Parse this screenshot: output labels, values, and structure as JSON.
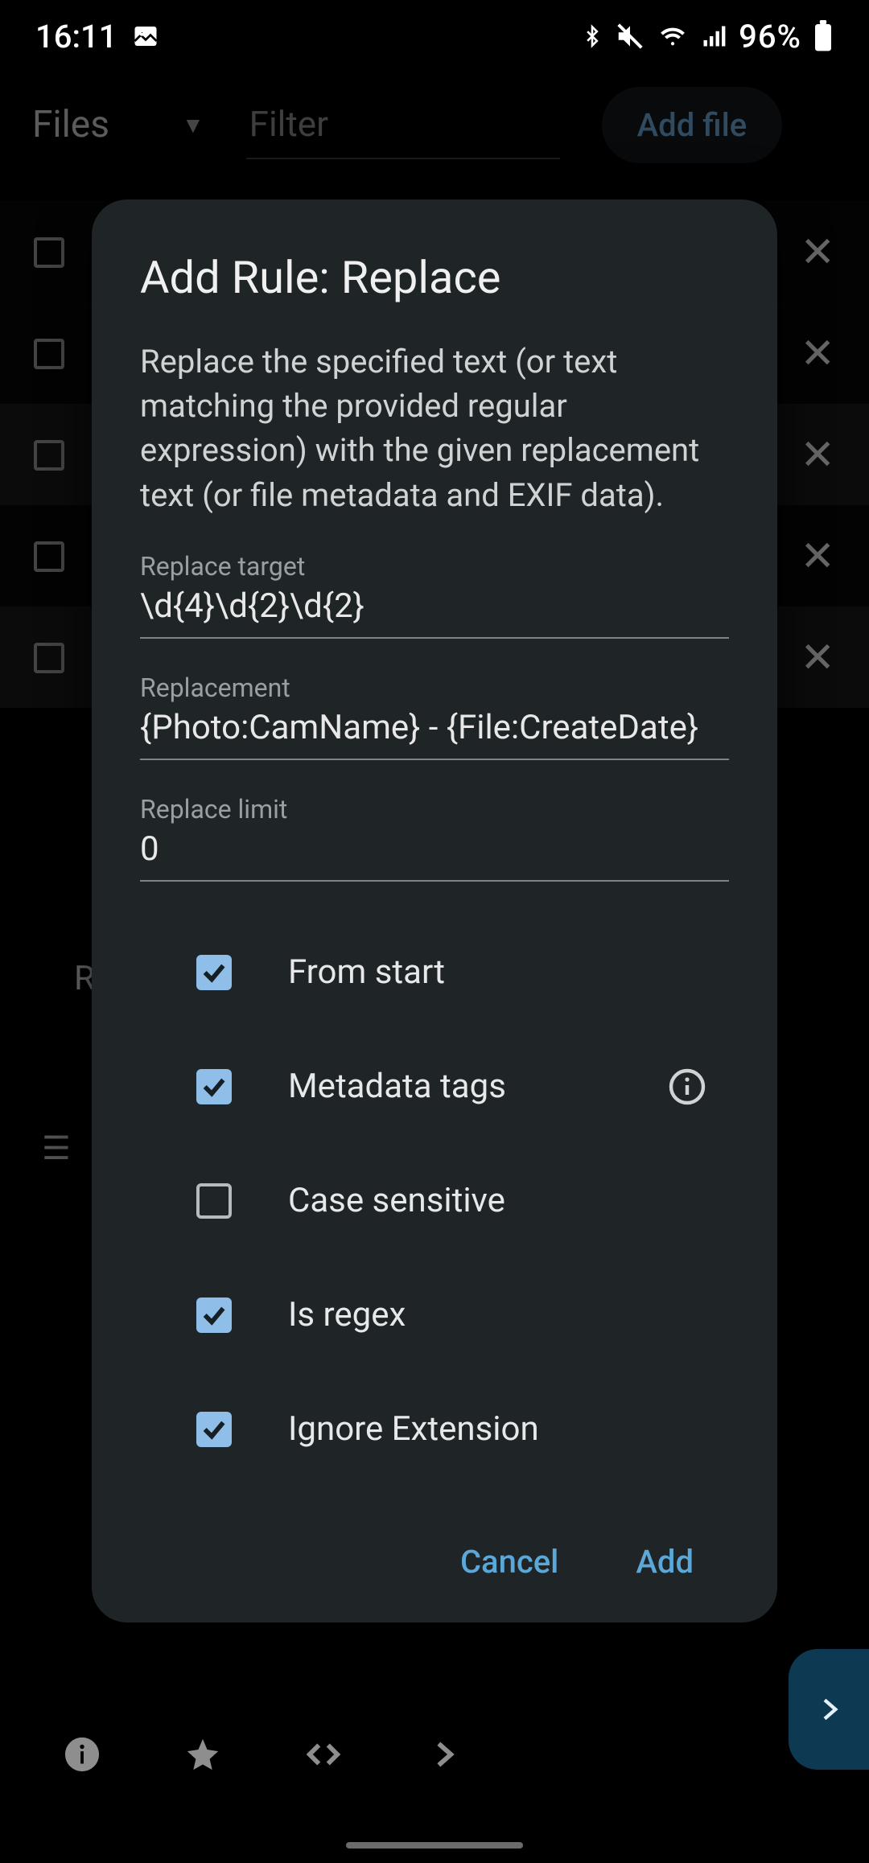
{
  "status": {
    "time": "16:11",
    "battery": "96%"
  },
  "appbar": {
    "spinner_label": "Files",
    "filter_placeholder": "Filter",
    "addfile_label": "Add file"
  },
  "bg": {
    "letter_r": "R"
  },
  "dialog": {
    "title": "Add Rule: Replace",
    "description": "Replace the specified text (or text matching the provided regular expression) with the given replacement text (or file metadata and EXIF data).",
    "fields": {
      "replace_target": {
        "label": "Replace target",
        "value": "\\d{4}\\d{2}\\d{2}"
      },
      "replacement": {
        "label": "Replacement",
        "value": "{Photo:CamName} - {File:CreateDate}"
      },
      "replace_limit": {
        "label": "Replace limit",
        "value": "0"
      }
    },
    "checks": {
      "from_start": {
        "label": "From start",
        "checked": true
      },
      "metadata_tags": {
        "label": "Metadata tags",
        "checked": true
      },
      "case_sensitive": {
        "label": "Case sensitive",
        "checked": false
      },
      "is_regex": {
        "label": "Is regex",
        "checked": true
      },
      "ignore_extension": {
        "label": "Ignore Extension",
        "checked": true
      }
    },
    "actions": {
      "cancel_label": "Cancel",
      "add_label": "Add"
    }
  }
}
